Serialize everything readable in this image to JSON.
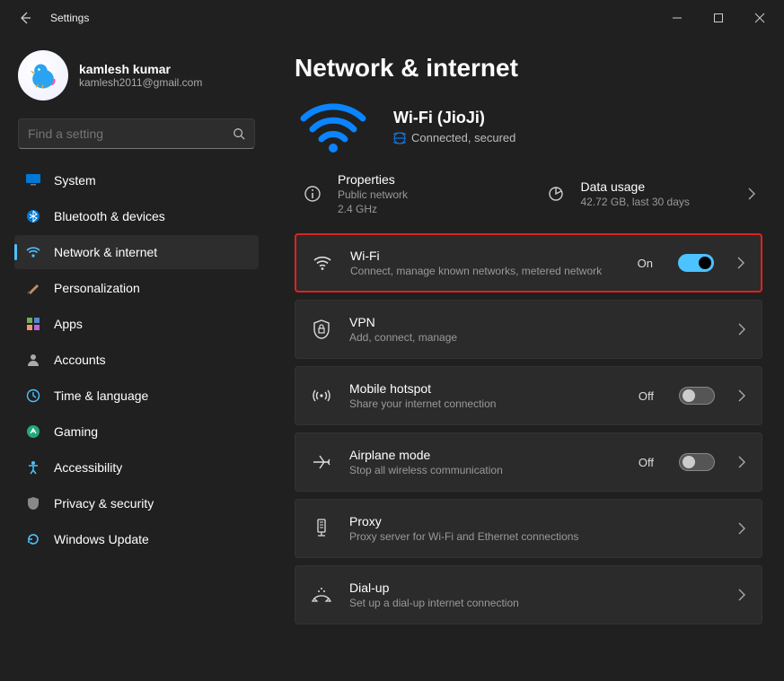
{
  "window": {
    "app_title": "Settings"
  },
  "user": {
    "name": "kamlesh kumar",
    "email": "kamlesh2011@gmail.com"
  },
  "search": {
    "placeholder": "Find a setting"
  },
  "sidebar": {
    "items": [
      {
        "label": "System",
        "icon": "monitor-icon"
      },
      {
        "label": "Bluetooth & devices",
        "icon": "bluetooth-icon"
      },
      {
        "label": "Network & internet",
        "icon": "wifi-icon",
        "selected": true
      },
      {
        "label": "Personalization",
        "icon": "paint-icon"
      },
      {
        "label": "Apps",
        "icon": "apps-icon"
      },
      {
        "label": "Accounts",
        "icon": "person-icon"
      },
      {
        "label": "Time & language",
        "icon": "clock-icon"
      },
      {
        "label": "Gaming",
        "icon": "gaming-icon"
      },
      {
        "label": "Accessibility",
        "icon": "accessibility-icon"
      },
      {
        "label": "Privacy & security",
        "icon": "shield-icon"
      },
      {
        "label": "Windows Update",
        "icon": "update-icon"
      }
    ]
  },
  "page": {
    "title": "Network & internet",
    "wifi": {
      "ssid_label": "Wi-Fi (JioJi)",
      "status": "Connected, secured"
    },
    "properties": {
      "title": "Properties",
      "line1": "Public network",
      "line2": "2.4 GHz"
    },
    "data_usage": {
      "title": "Data usage",
      "line": "42.72 GB, last 30 days"
    },
    "options": [
      {
        "title": "Wi-Fi",
        "sub": "Connect, manage known networks, metered network",
        "toggle": "On",
        "highlight": true
      },
      {
        "title": "VPN",
        "sub": "Add, connect, manage"
      },
      {
        "title": "Mobile hotspot",
        "sub": "Share your internet connection",
        "toggle": "Off"
      },
      {
        "title": "Airplane mode",
        "sub": "Stop all wireless communication",
        "toggle": "Off"
      },
      {
        "title": "Proxy",
        "sub": "Proxy server for Wi-Fi and Ethernet connections"
      },
      {
        "title": "Dial-up",
        "sub": "Set up a dial-up internet connection"
      }
    ]
  }
}
